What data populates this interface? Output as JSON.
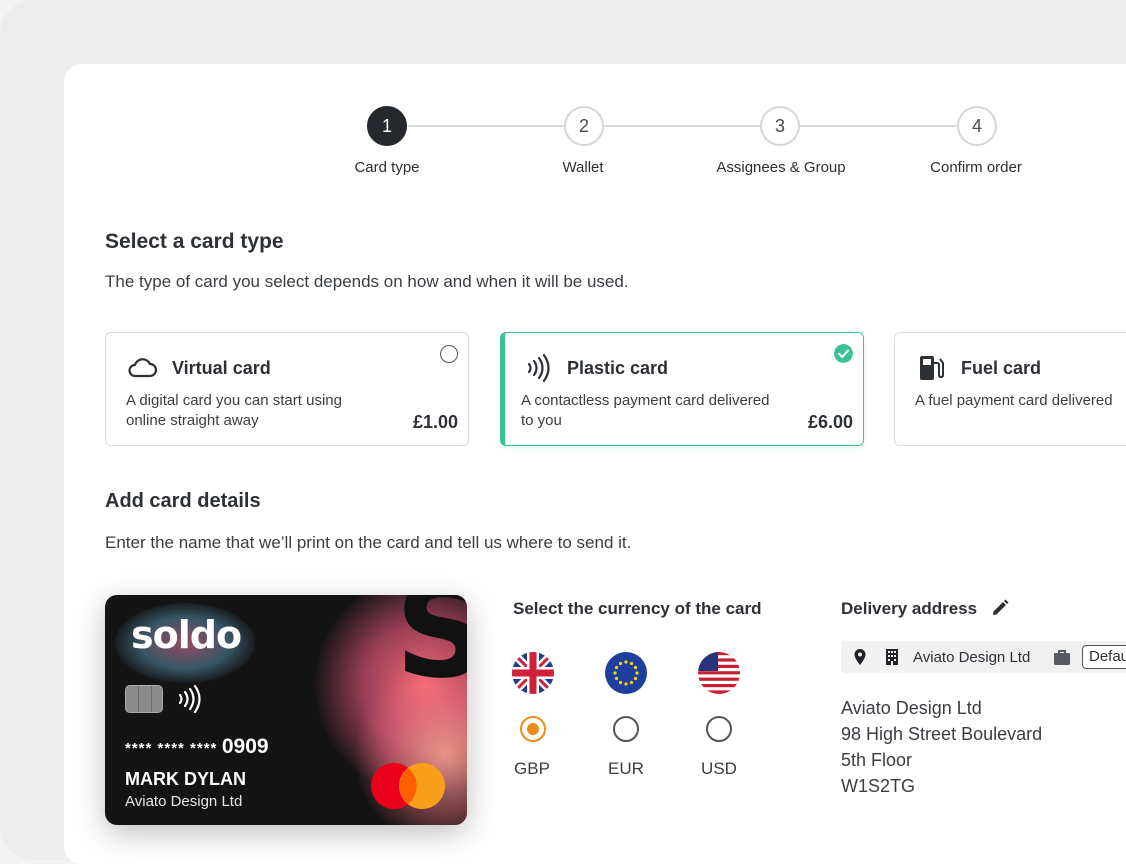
{
  "stepper": {
    "steps": [
      {
        "number": "1",
        "label": "Card type"
      },
      {
        "number": "2",
        "label": "Wallet"
      },
      {
        "number": "3",
        "label": "Assignees & Group"
      },
      {
        "number": "4",
        "label": "Confirm order"
      }
    ],
    "active_step": 1
  },
  "card_type_section": {
    "title": "Select a card type",
    "description": "The type of card you select depends on how and when it will be used.",
    "options": [
      {
        "icon": "cloud-icon",
        "title": "Virtual card",
        "description": "A digital card you can start using online straight away",
        "price": "£1.00",
        "selected": false
      },
      {
        "icon": "contactless-icon",
        "title": "Plastic card",
        "description": "A contactless payment card delivered to you",
        "price": "£6.00",
        "selected": true
      },
      {
        "icon": "fuel-pump-icon",
        "title": "Fuel card",
        "description": "A fuel payment card delivered",
        "price": "",
        "selected": false
      }
    ]
  },
  "card_details_section": {
    "title": "Add card details",
    "description": "Enter the name that we’ll print on the card and tell us where to send it."
  },
  "card_preview": {
    "brand": "soldo",
    "big_letter": "S",
    "number_mask": "**** **** ****",
    "number_last": "0909",
    "holder_name": "MARK DYLAN",
    "company": "Aviato Design Ltd"
  },
  "currency": {
    "title": "Select the currency of the card",
    "options": [
      {
        "code": "GBP",
        "flag": "uk-flag-icon",
        "selected": true
      },
      {
        "code": "EUR",
        "flag": "eu-flag-icon",
        "selected": false
      },
      {
        "code": "USD",
        "flag": "us-flag-icon",
        "selected": false
      }
    ],
    "accent_color": "#f08a1c"
  },
  "delivery": {
    "title": "Delivery address",
    "chip_name": "Aviato Design Ltd",
    "chip_badge": "Default",
    "address_lines": [
      "Aviato Design Ltd",
      "98 High Street Boulevard",
      "5th Floor",
      "W1S2TG"
    ]
  },
  "colors": {
    "selected_border": "#3cc097",
    "active_step": "#25292e"
  }
}
